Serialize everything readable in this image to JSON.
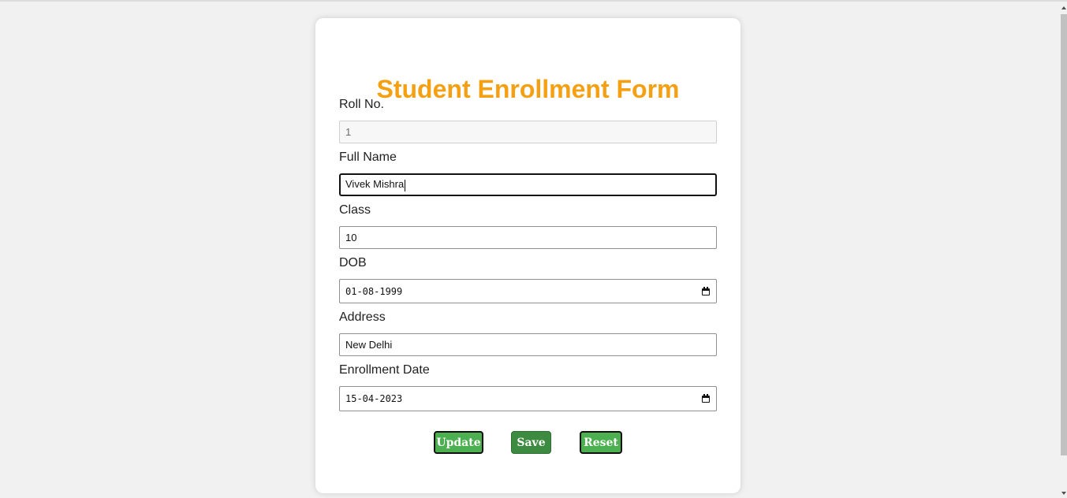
{
  "form": {
    "title": "Student Enrollment Form",
    "fields": [
      {
        "label": "Roll No.",
        "value": "1",
        "type": "text",
        "readonly": true
      },
      {
        "label": "Full Name",
        "value": "Vivek Mishra",
        "type": "text",
        "focused": true
      },
      {
        "label": "Class",
        "value": "10",
        "type": "text"
      },
      {
        "label": "DOB",
        "value": "01-08-1999",
        "type": "date"
      },
      {
        "label": "Address",
        "value": "New Delhi",
        "type": "text"
      },
      {
        "label": "Enrollment Date",
        "value": "15-04-2023",
        "type": "date"
      }
    ],
    "buttons": {
      "update": "Update",
      "save": "Save",
      "reset": "Reset"
    }
  },
  "colors": {
    "title": "#f5a013",
    "button": "#4caf50",
    "button_active": "#3d8b40",
    "background": "#f1f1f1"
  },
  "icons": {
    "date_picker": "calendar-icon"
  }
}
